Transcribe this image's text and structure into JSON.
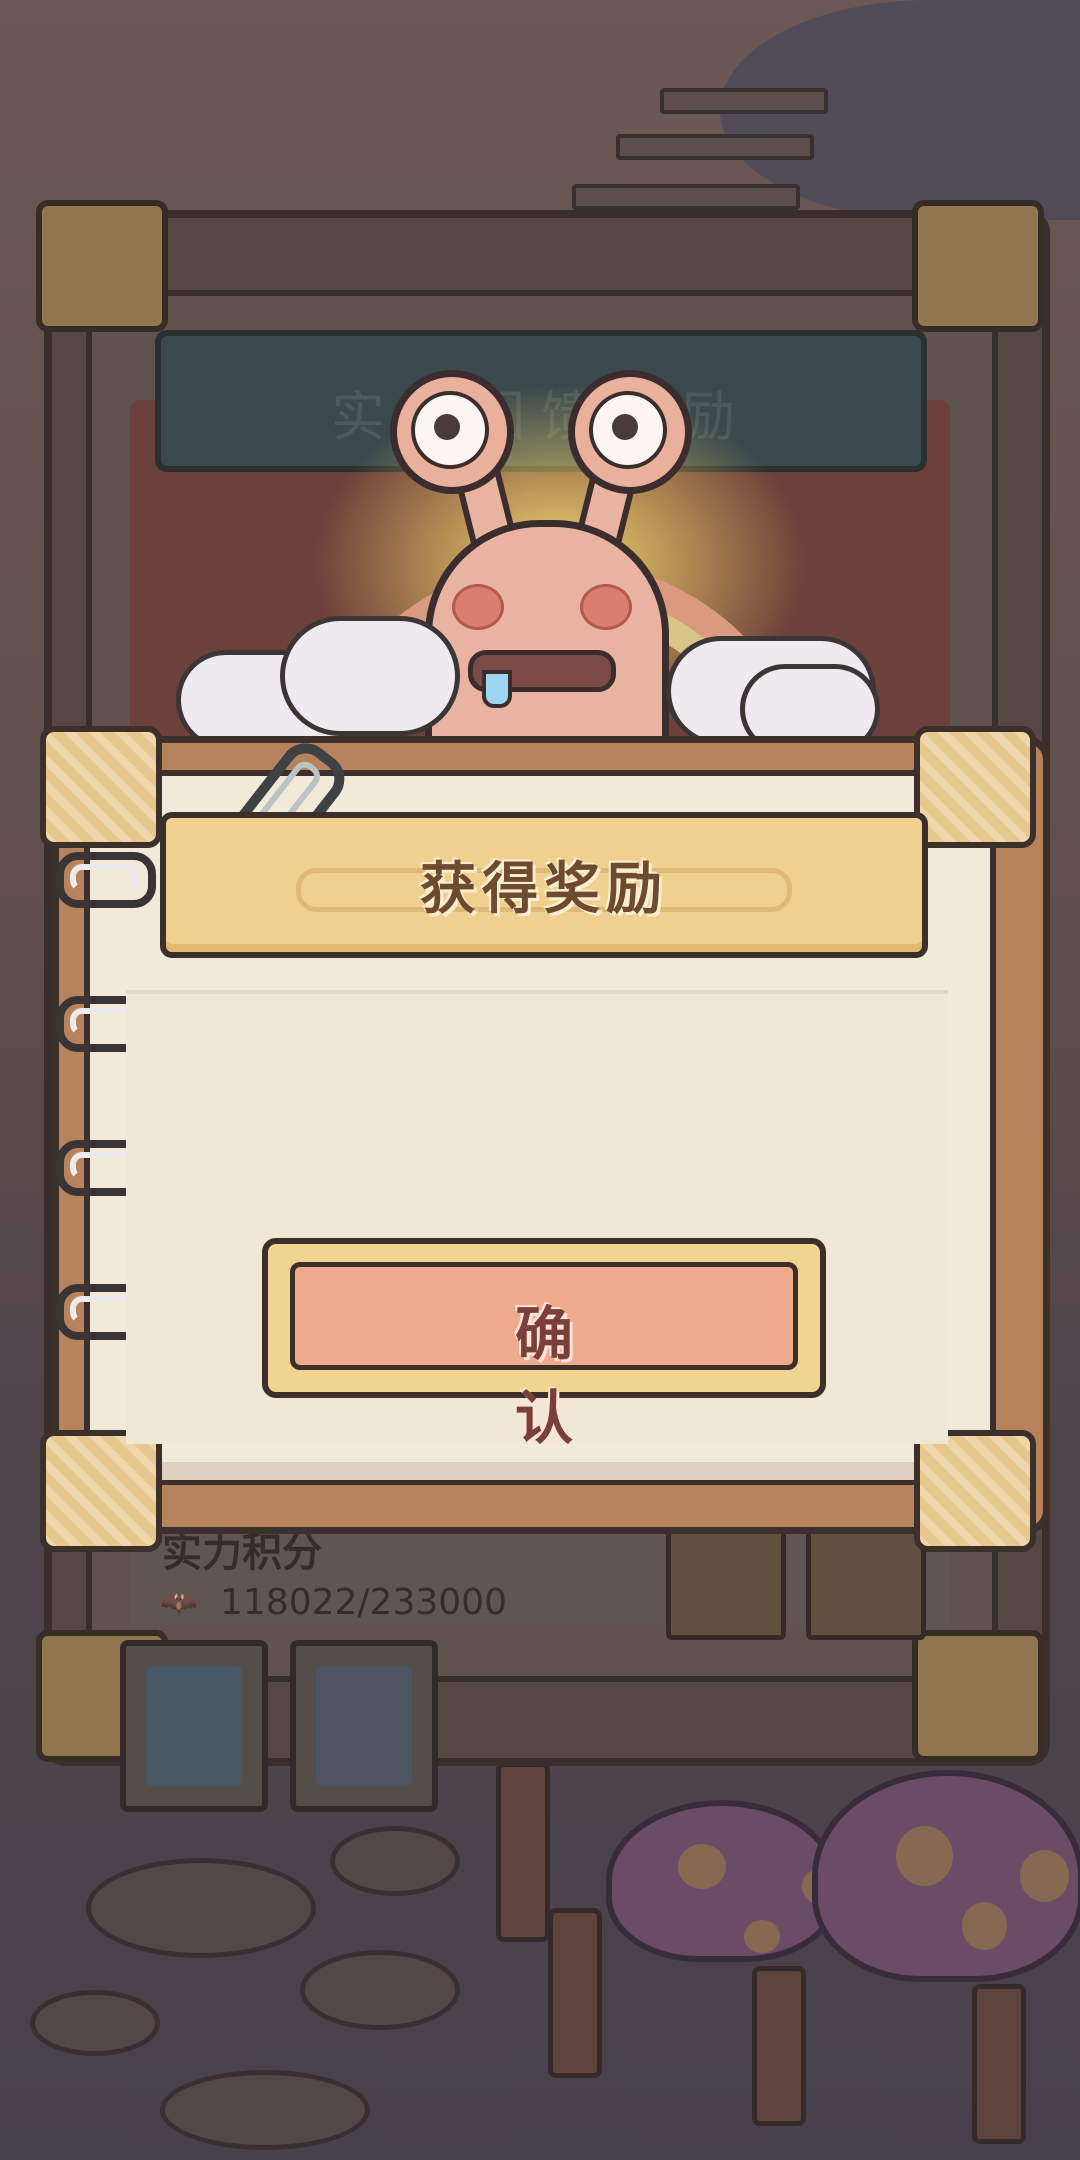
{
  "background": {
    "top_banner_text": "实力回馈奖励"
  },
  "score": {
    "label": "实力积分",
    "value": "118022/233000"
  },
  "dialog": {
    "title": "获得奖励",
    "confirm_label": "确　认"
  },
  "icons": [
    "snail-mascot",
    "mushroom-icon",
    "blob-icon",
    "bat-icon",
    "snail-tab-icon",
    "gift-tab-icon",
    "binder-ring-icon",
    "paperclip-icon"
  ],
  "colors": {
    "dialog_paper": "#f2ead9",
    "title_bar": "#f0d08f",
    "confirm_button": "#eeaa8d",
    "frame_wood": "#b7835d"
  }
}
